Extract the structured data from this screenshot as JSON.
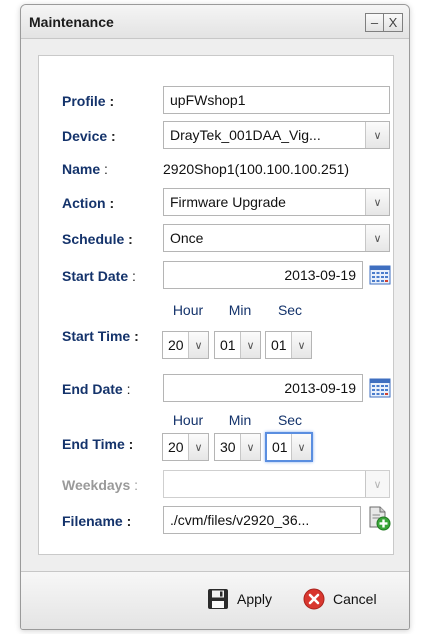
{
  "window": {
    "title": "Maintenance",
    "minimize_glyph": "–",
    "close_glyph": "X"
  },
  "form": {
    "profile": {
      "label": "Profile",
      "value": "upFWshop1"
    },
    "device": {
      "label": "Device",
      "value": "DrayTek_001DAA_Vig..."
    },
    "name": {
      "label": "Name",
      "value": "2920Shop1(100.100.100.251)"
    },
    "action": {
      "label": "Action",
      "value": "Firmware Upgrade"
    },
    "schedule": {
      "label": "Schedule",
      "value": "Once"
    },
    "start_date": {
      "label": "Start Date",
      "value": "2013-09-19"
    },
    "start_time": {
      "label": "Start Time",
      "hour_label": "Hour",
      "min_label": "Min",
      "sec_label": "Sec",
      "hour": "20",
      "min": "01",
      "sec": "01"
    },
    "end_date": {
      "label": "End Date",
      "value": "2013-09-19"
    },
    "end_time": {
      "label": "End Time",
      "hour_label": "Hour",
      "min_label": "Min",
      "sec_label": "Sec",
      "hour": "20",
      "min": "30",
      "sec": "01"
    },
    "weekdays": {
      "label": "Weekdays",
      "value": ""
    },
    "filename": {
      "label": "Filename",
      "value": "./cvm/files/v2920_36..."
    },
    "colon": ":"
  },
  "footer": {
    "apply_label": "Apply",
    "cancel_label": "Cancel"
  },
  "icons": {
    "calendar": "calendar-icon",
    "add_file": "add-file-icon",
    "save": "save-icon",
    "cancel": "cancel-icon"
  },
  "colors": {
    "label": "#14336b",
    "focus": "#5a8ee0",
    "cancel_red": "#d8372f",
    "add_green": "#3aa63a"
  }
}
